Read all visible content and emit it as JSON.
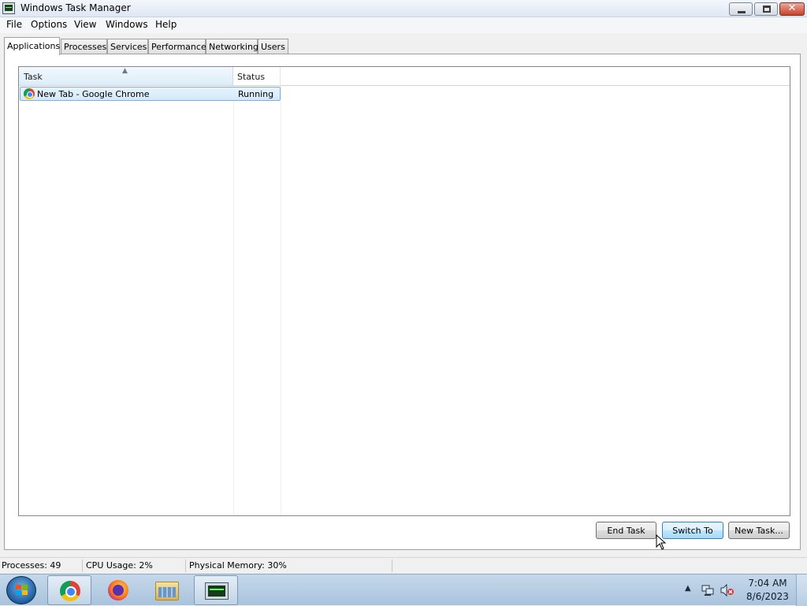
{
  "window": {
    "title": "Windows Task Manager",
    "icon": "task-manager-icon",
    "controls": {
      "minimize": "minimize-icon",
      "maximize": "restore-icon",
      "close": "✕"
    }
  },
  "menu": [
    "File",
    "Options",
    "View",
    "Windows",
    "Help"
  ],
  "tabs": [
    {
      "label": "Applications",
      "active": true
    },
    {
      "label": "Processes",
      "active": false
    },
    {
      "label": "Services",
      "active": false
    },
    {
      "label": "Performance",
      "active": false
    },
    {
      "label": "Networking",
      "active": false
    },
    {
      "label": "Users",
      "active": false
    }
  ],
  "list": {
    "columns": [
      "Task",
      "Status"
    ],
    "sorted_column": "Task",
    "rows": [
      {
        "icon": "chrome-icon",
        "task": "New Tab - Google Chrome",
        "status": "Running",
        "selected": true
      }
    ]
  },
  "buttons": {
    "end_task": "End Task",
    "switch_to": "Switch To",
    "new_task": "New Task..."
  },
  "statusbar": {
    "processes": "Processes: 49",
    "cpu": "CPU Usage: 2%",
    "memory": "Physical Memory: 30%"
  },
  "taskbar": {
    "pinned": [
      "chrome-icon",
      "firefox-icon",
      "file-explorer-icon",
      "task-manager-icon"
    ],
    "tray_arrow": "▲",
    "time": "7:04 AM",
    "date": "8/6/2023",
    "colors": {
      "taskbar": "#b9d0e6",
      "selection": "#d4e9fb"
    }
  }
}
